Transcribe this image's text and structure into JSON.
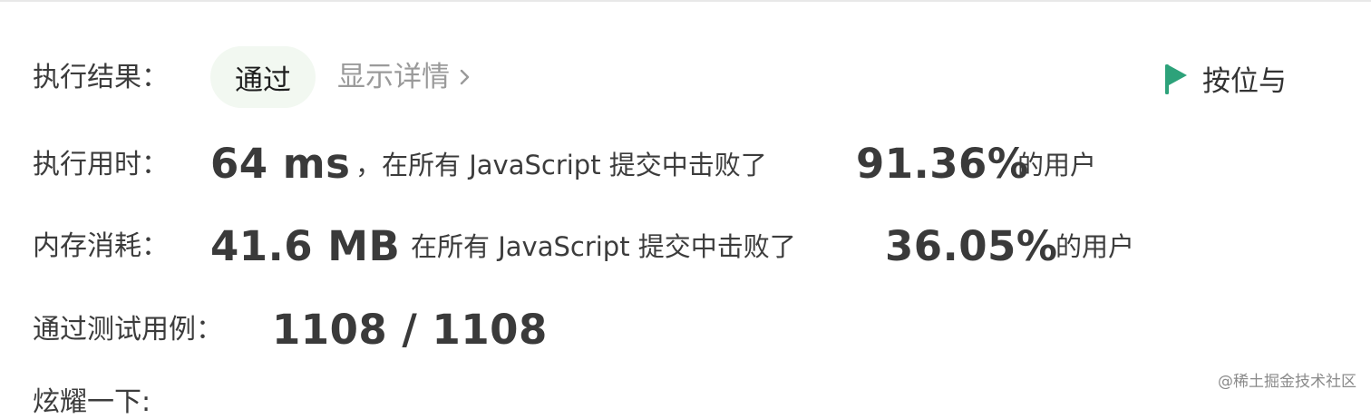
{
  "result": {
    "label": "执行结果：",
    "status": "通过",
    "details": "显示详情",
    "action": "按位与",
    "accent": "#2da27a"
  },
  "runtime": {
    "label": "执行用时：",
    "value": "64 ms",
    "mid_text": "，在所有 JavaScript 提交中击败了",
    "percent": "91.36%",
    "suffix": "的用户"
  },
  "memory": {
    "label": "内存消耗：",
    "value": "41.6 MB",
    "mid_text": "，在所有 JavaScript 提交中击败了",
    "percent": "36.05%",
    "suffix": "的用户"
  },
  "tests": {
    "label": "通过测试用例：",
    "value": "1108 / 1108"
  },
  "partial_row": {
    "label": "炫耀一下:"
  },
  "watermark": "@稀土掘金技术社区"
}
